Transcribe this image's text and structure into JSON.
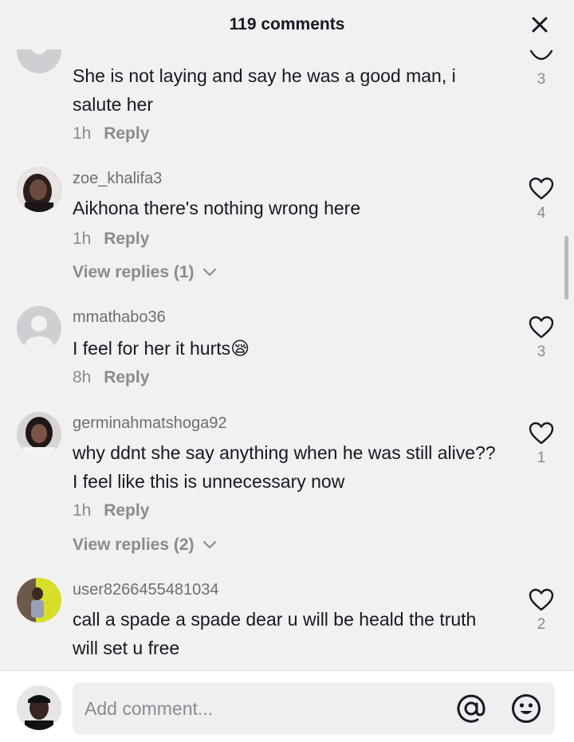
{
  "header": {
    "title": "119 comments",
    "close_icon": "close-icon"
  },
  "comments": [
    {
      "username": "",
      "text": "She is not laying and say he was a good man, i salute her",
      "time": "1h",
      "reply_label": "Reply",
      "likes": "3",
      "view_replies": ""
    },
    {
      "username": "zoe_khalifa3",
      "text": "Aikhona there's nothing wrong here",
      "time": "1h",
      "reply_label": "Reply",
      "likes": "4",
      "view_replies": "View replies (1)"
    },
    {
      "username": "mmathabo36",
      "text": "I feel for her it hurts😪",
      "time": "8h",
      "reply_label": "Reply",
      "likes": "3",
      "view_replies": ""
    },
    {
      "username": "germinahmatshoga92",
      "text": "why ddnt she say anything when he was still alive?? I feel like this is unnecessary now",
      "time": "1h",
      "reply_label": "Reply",
      "likes": "1",
      "view_replies": "View replies (2)"
    },
    {
      "username": "user8266455481034",
      "text": "call a spade a spade dear u will be heald the truth will set u free",
      "time": "",
      "reply_label": "",
      "likes": "2",
      "view_replies": ""
    }
  ],
  "composer": {
    "placeholder": "Add comment...",
    "mention_icon": "at-sign-icon",
    "emoji_icon": "smiley-face-icon"
  },
  "colors": {
    "background": "#f1f1f2",
    "text_primary": "#161823",
    "text_secondary": "#8a8b91"
  }
}
